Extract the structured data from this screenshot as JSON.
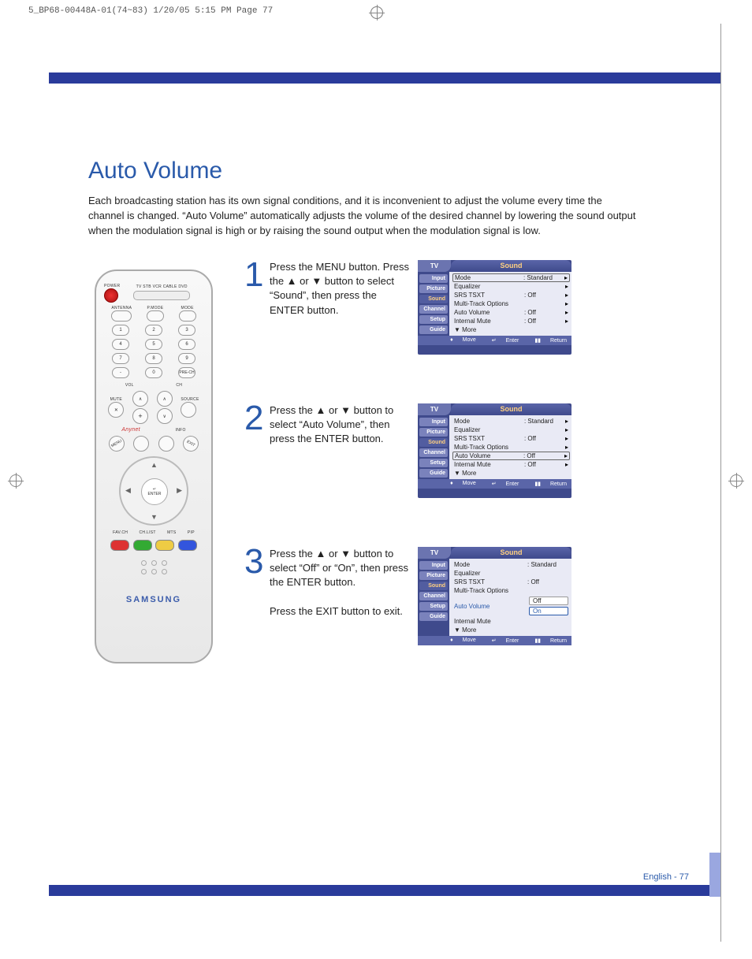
{
  "print_header": "5_BP68-00448A-01(74~83)  1/20/05  5:15 PM  Page 77",
  "title": "Auto Volume",
  "intro": "Each broadcasting station has its own signal conditions, and it is inconvenient to adjust the volume every time the channel is changed. “Auto Volume” automatically adjusts the volume of the desired channel by lowering the sound output when the modulation signal is high or by raising the sound output when the modulation signal is low.",
  "steps": [
    {
      "num": "1",
      "text": "Press the MENU button. Press the ▲ or ▼ button to select “Sound”, then press the ENTER button."
    },
    {
      "num": "2",
      "text": "Press the ▲ or ▼ button to select “Auto Volume”, then press the ENTER button."
    },
    {
      "num": "3",
      "text": "Press the ▲ or ▼ button to select “Off” or “On”, then press the ENTER button.\n\nPress the EXIT button to exit."
    }
  ],
  "osd": {
    "tv": "TV",
    "title": "Sound",
    "side": [
      "Input",
      "Picture",
      "Sound",
      "Channel",
      "Setup",
      "Guide"
    ],
    "side_sel_index": 2,
    "rows": [
      {
        "label": "Mode",
        "value": ": Standard"
      },
      {
        "label": "Equalizer",
        "value": ""
      },
      {
        "label": "SRS TSXT",
        "value": ": Off"
      },
      {
        "label": "Multi-Track Options",
        "value": ""
      },
      {
        "label": "Auto Volume",
        "value": ": Off"
      },
      {
        "label": "Internal Mute",
        "value": ": Off"
      },
      {
        "label": "▼ More",
        "value": ""
      }
    ],
    "screen1_hl_index": 0,
    "screen2_hl_index": 4,
    "screen3": {
      "auto_volume_label": "Auto Volume",
      "options": [
        "Off",
        "On"
      ],
      "selected_index": 1
    },
    "hints": {
      "move": "Move",
      "enter": "Enter",
      "return": "Return"
    }
  },
  "remote": {
    "power_label": "POWER",
    "mode_row": "TV  STB  VCR  CABLE  DVD",
    "antenna": "ANTENNA",
    "pmode": "P.MODE",
    "mode": "MODE",
    "numpad": [
      "1",
      "2",
      "3",
      "4",
      "5",
      "6",
      "7",
      "8",
      "9",
      "-",
      "0",
      "PRE-CH"
    ],
    "vol": "VOL",
    "ch": "CH",
    "mute": "MUTE",
    "source": "SOURCE",
    "anynet": "Anynet",
    "info": "INFO",
    "menu": "MENU",
    "exit": "EXIT",
    "enter": "ENTER",
    "enter_icon": "↵",
    "bottom_row": [
      "FAV.CH",
      "CH.LIST",
      "MTS",
      "PIP"
    ],
    "brand": "SAMSUNG"
  },
  "footer": "English - 77"
}
